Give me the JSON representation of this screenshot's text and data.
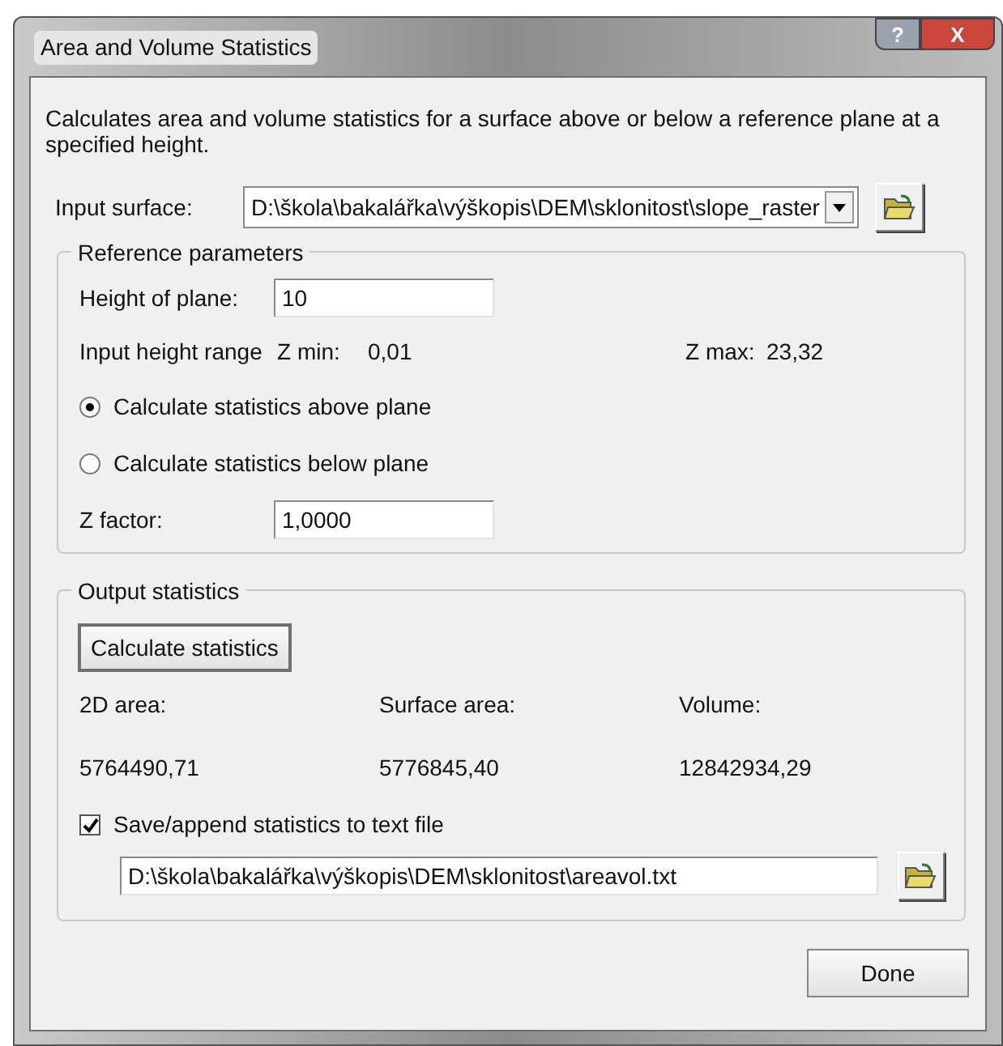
{
  "window": {
    "title": "Area and Volume Statistics",
    "buttons": [
      {
        "kind": "help",
        "label": "?"
      },
      {
        "kind": "close",
        "label": "X"
      }
    ]
  },
  "description": "Calculates area and volume statistics for a surface above or below a reference plane at a specified height.",
  "input_surface": {
    "label": "Input surface:",
    "value": "D:\\škola\\bakalářka\\výškopis\\DEM\\sklonitost\\slope_raster"
  },
  "reference_parameters": {
    "title": "Reference parameters",
    "height_of_plane": {
      "label": "Height of plane:",
      "value": "10"
    },
    "range": {
      "label": "Input height range",
      "zmin_label": "Z min:",
      "zmin": "0,01",
      "zmax_label": "Z max:",
      "zmax": "23,32"
    },
    "options": [
      {
        "label": "Calculate statistics above plane",
        "selected": true
      },
      {
        "label": "Calculate statistics below plane",
        "selected": false
      }
    ],
    "z_factor": {
      "label": "Z factor:",
      "value": "1,0000"
    }
  },
  "output_statistics": {
    "title": "Output statistics",
    "button": "Calculate statistics",
    "columns": [
      {
        "label": "2D area:",
        "value": "5764490,71"
      },
      {
        "label": "Surface area:",
        "value": "5776845,40"
      },
      {
        "label": "Volume:",
        "value": "12842934,29"
      }
    ],
    "save": {
      "label": "Save/append statistics to text file",
      "checked": true
    },
    "file": "D:\\škola\\bakalářka\\výškopis\\DEM\\sklonitost\\areavol.txt"
  },
  "done_button": "Done"
}
